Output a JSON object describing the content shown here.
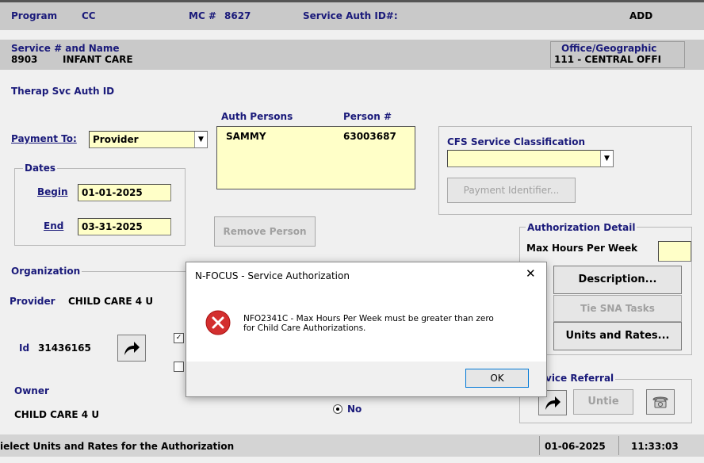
{
  "header": {
    "program_label": "Program",
    "program_value": "CC",
    "mc_label": "MC #",
    "mc_value": "8627",
    "service_auth_id_label": "Service Auth ID#:",
    "mode": "ADD"
  },
  "service": {
    "label": "Service # and Name",
    "number": "8903",
    "name": "INFANT CARE",
    "office_label": "Office/Geographic",
    "office_value": "111  - CENTRAL OFFI"
  },
  "therap_label": "Therap Svc Auth ID",
  "payment": {
    "label": "Payment To:",
    "value": "Provider"
  },
  "auth_persons": {
    "header_name": "Auth Persons",
    "header_number": "Person #",
    "rows": [
      {
        "name": "SAMMY",
        "number": "63003687"
      }
    ],
    "remove_button": "Remove Person"
  },
  "dates": {
    "group_label": "Dates",
    "begin_label": "Begin",
    "begin_value": "01-01-2025",
    "end_label": "End",
    "end_value": "03-31-2025"
  },
  "cfs": {
    "label": "CFS Service Classification",
    "value": "",
    "payment_identifier_button": "Payment Identifier..."
  },
  "authorization_detail": {
    "group_label": "Authorization Detail",
    "max_hours_label": "Max Hours Per Week",
    "max_hours_value": "",
    "description_button": "Description...",
    "tie_sna_button": "Tie SNA Tasks",
    "units_rates_button": "Units and Rates..."
  },
  "organization": {
    "group_label": "Organization",
    "provider_label": "Provider",
    "provider_value": "CHILD CARE 4 U",
    "id_label": "Id",
    "id_value": "31436165",
    "owner_label": "Owner",
    "owner_value": "CHILD CARE 4 U"
  },
  "radio_no_label": "No",
  "service_referral": {
    "group_label": "vice Referral",
    "untie_button": "Untie"
  },
  "dialog": {
    "title": "N-FOCUS - Service Authorization",
    "close": "✕",
    "message_line1": "NFO2341C - Max Hours Per Week must be greater than zero",
    "message_line2": "for Child Care Authorizations.",
    "ok_button": "OK"
  },
  "status": {
    "message": "ielect Units and Rates for the Authorization",
    "date": "01-06-2025",
    "time": "11:33:03"
  }
}
